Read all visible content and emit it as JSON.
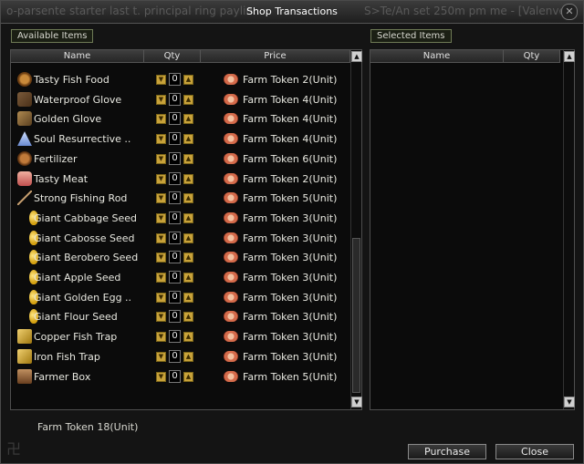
{
  "window": {
    "title": "Shop Transactions",
    "chat_left": "o-parsente starter last t. principal ring paylin...",
    "chat_right": "S>Te/An set 250m pm me - [Valenvel]"
  },
  "available": {
    "tab_label": "Available Items",
    "columns": {
      "name": "Name",
      "qty": "Qty",
      "price": "Price"
    },
    "items": [
      {
        "name": "Tasty Fish Food",
        "qty": "0",
        "price": "Farm Token  2(Unit)",
        "icon": "fish-food-icon"
      },
      {
        "name": "Waterproof Glove",
        "qty": "0",
        "price": "Farm Token  4(Unit)",
        "icon": "glove-icon"
      },
      {
        "name": "Golden Glove",
        "qty": "0",
        "price": "Farm Token  4(Unit)",
        "icon": "golden-glove-icon"
      },
      {
        "name": "Soul Resurrective ..",
        "qty": "0",
        "price": "Farm Token  4(Unit)",
        "icon": "potion-icon"
      },
      {
        "name": "Fertilizer",
        "qty": "0",
        "price": "Farm Token  6(Unit)",
        "icon": "fertilizer-icon"
      },
      {
        "name": "Tasty Meat",
        "qty": "0",
        "price": "Farm Token  2(Unit)",
        "icon": "meat-icon"
      },
      {
        "name": "Strong Fishing Rod",
        "qty": "0",
        "price": "Farm Token  5(Unit)",
        "icon": "fishing-rod-icon"
      },
      {
        "name": "Giant Cabbage Seed",
        "qty": "0",
        "price": "Farm Token  3(Unit)",
        "icon": "seed-icon"
      },
      {
        "name": "Giant Cabosse Seed",
        "qty": "0",
        "price": "Farm Token  3(Unit)",
        "icon": "seed-icon"
      },
      {
        "name": "Giant Berobero Seed",
        "qty": "0",
        "price": "Farm Token  3(Unit)",
        "icon": "seed-icon"
      },
      {
        "name": "Giant Apple Seed",
        "qty": "0",
        "price": "Farm Token  3(Unit)",
        "icon": "seed-icon"
      },
      {
        "name": "Giant Golden Egg ..",
        "qty": "0",
        "price": "Farm Token  3(Unit)",
        "icon": "seed-icon"
      },
      {
        "name": "Giant Flour Seed",
        "qty": "0",
        "price": "Farm Token  3(Unit)",
        "icon": "seed-icon"
      },
      {
        "name": "Copper Fish Trap",
        "qty": "0",
        "price": "Farm Token  3(Unit)",
        "icon": "fish-trap-icon"
      },
      {
        "name": "Iron Fish Trap",
        "qty": "0",
        "price": "Farm Token  3(Unit)",
        "icon": "fish-trap-icon"
      },
      {
        "name": "Farmer Box",
        "qty": "0",
        "price": "Farm Token  5(Unit)",
        "icon": "box-icon"
      }
    ]
  },
  "selected": {
    "tab_label": "Selected Items",
    "columns": {
      "name": "Name",
      "qty": "Qty"
    }
  },
  "footer": {
    "total": "Farm Token 18(Unit)",
    "purchase_label": "Purchase",
    "close_label": "Close"
  }
}
